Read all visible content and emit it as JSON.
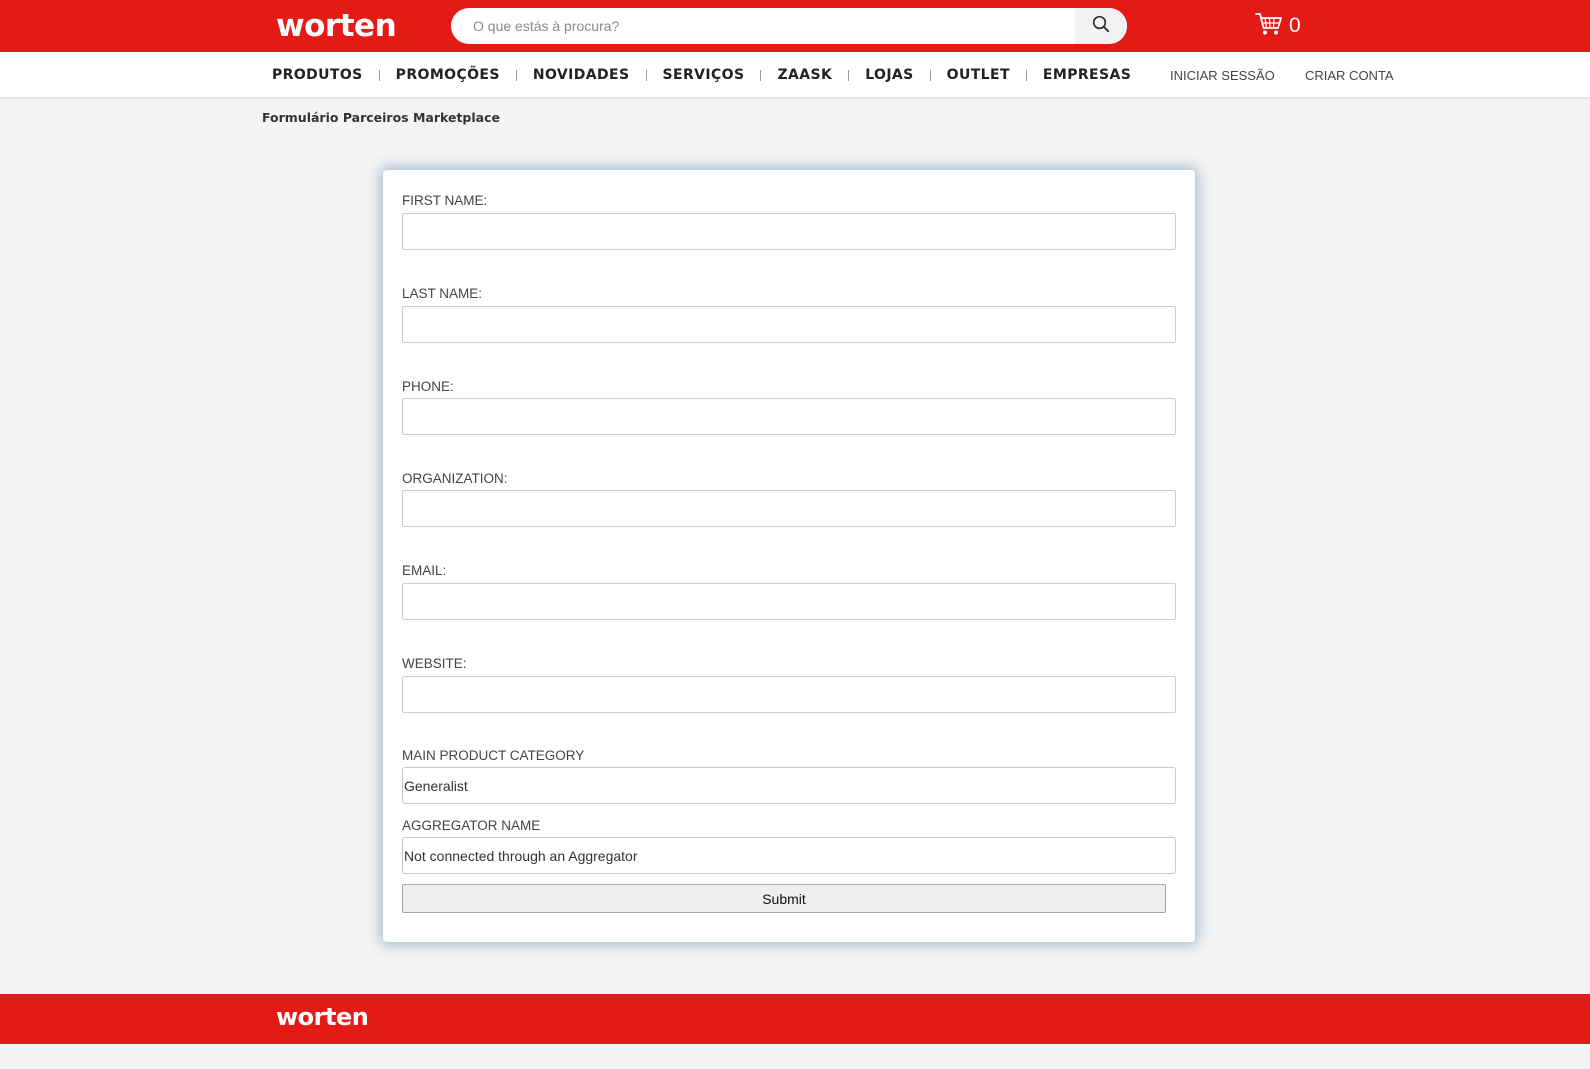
{
  "header": {
    "logo": "worten",
    "search_placeholder": "O que estás à procura?",
    "cart_count": "0"
  },
  "nav": {
    "items": [
      "PRODUTOS",
      "PROMOÇÕES",
      "NOVIDADES",
      "SERVIÇOS",
      "ZAASK",
      "LOJAS",
      "OUTLET",
      "EMPRESAS"
    ],
    "login": "INICIAR SESSÃO",
    "register": "CRIAR CONTA"
  },
  "breadcrumb": "Formulário Parceiros Marketplace",
  "form": {
    "first_name_label": "FIRST NAME:",
    "last_name_label": "LAST NAME:",
    "phone_label": "PHONE:",
    "organization_label": "ORGANIZATION:",
    "email_label": "EMAIL:",
    "website_label": "WEBSITE:",
    "category_label": "MAIN PRODUCT CATEGORY",
    "category_value": "Generalist",
    "aggregator_label": "AGGREGATOR NAME",
    "aggregator_value": "Not connected through an Aggregator",
    "submit_label": "Submit"
  },
  "footer": {
    "logo": "worten"
  },
  "colors": {
    "brand_red": "#e41a16",
    "background": "#f4f4f4"
  }
}
